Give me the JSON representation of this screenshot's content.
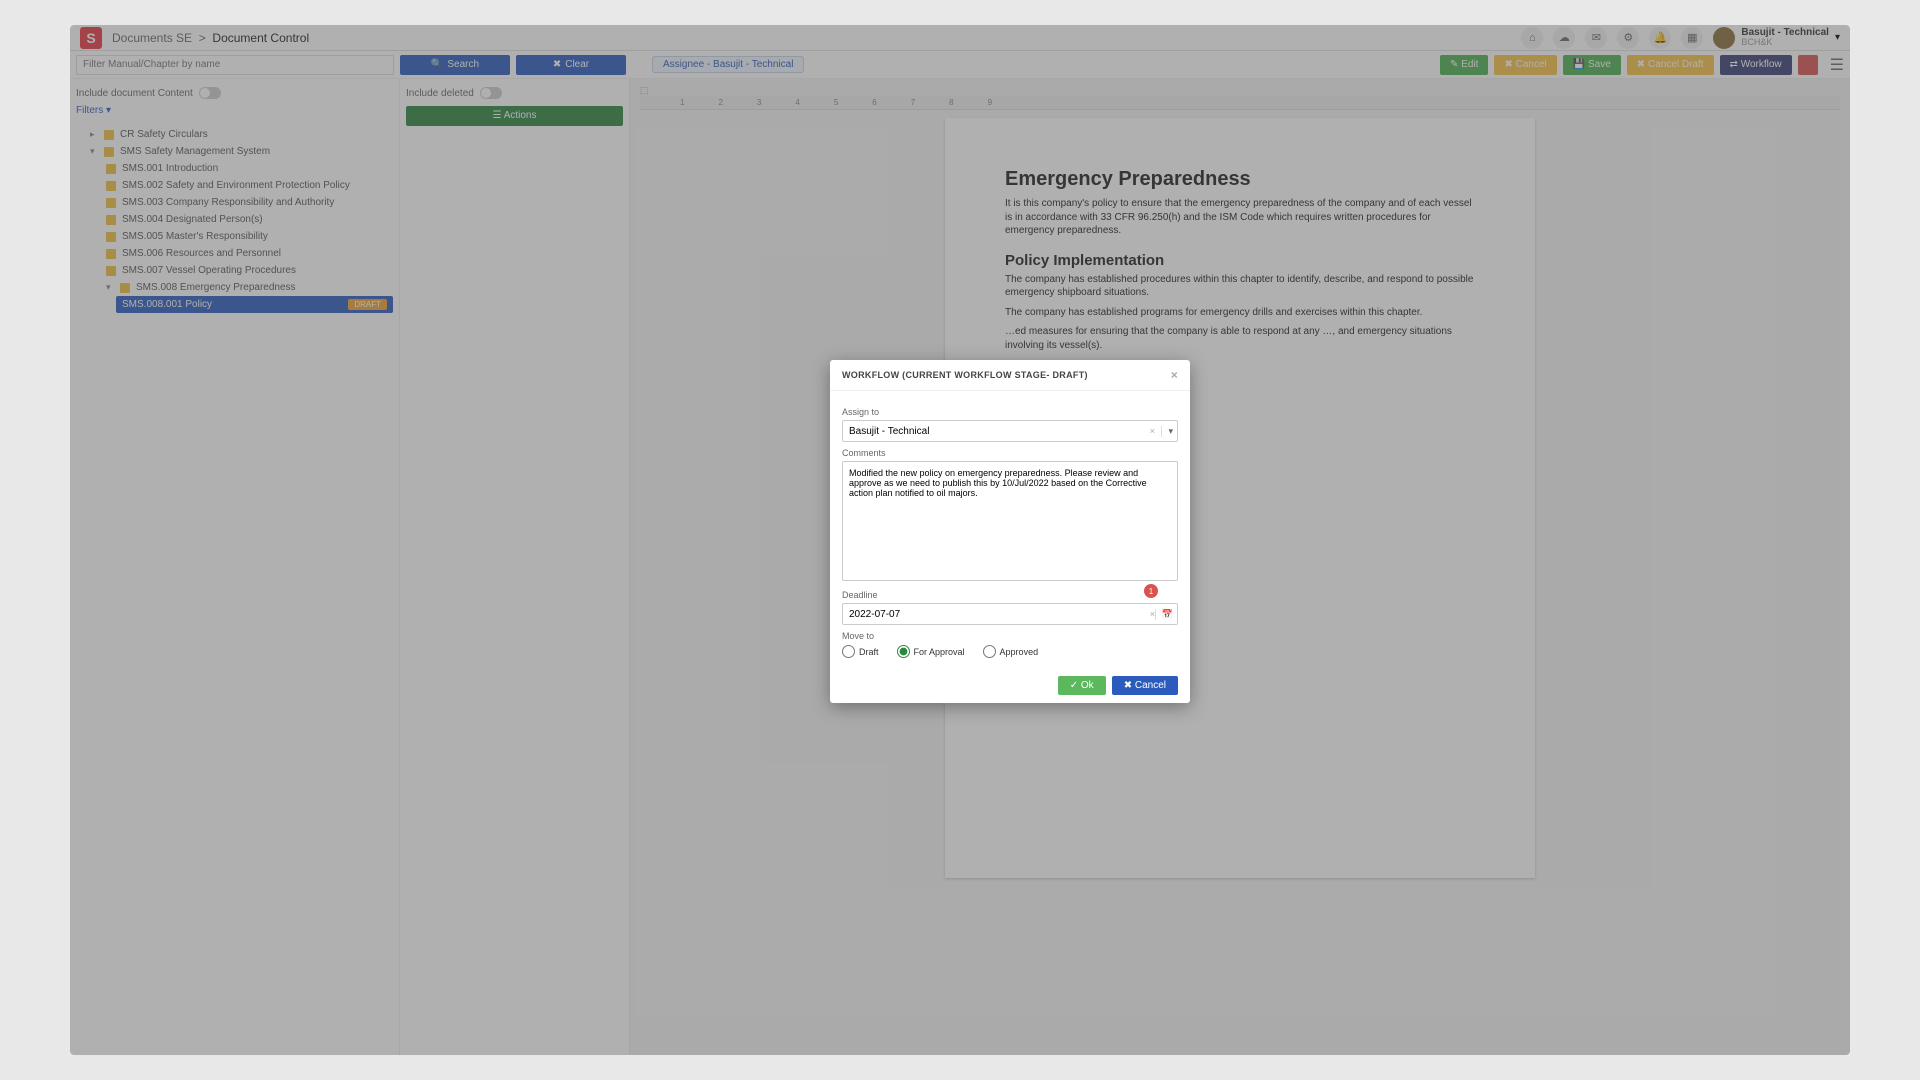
{
  "header": {
    "logo_letter": "S",
    "breadcrumb_app": "Documents SE",
    "breadcrumb_sep": ">",
    "breadcrumb_page": "Document Control",
    "user_name": "Basujit - Technical",
    "user_org": "BCH&K"
  },
  "toolbar": {
    "filter_placeholder": "Filter Manual/Chapter by name",
    "search_label": "Search",
    "clear_label": "Clear",
    "assignee_label": "Assignee - Basujit - Technical",
    "edit_label": "Edit",
    "cancel_label": "Cancel",
    "save_label": "Save",
    "cancel_draft_label": "Cancel Draft",
    "workflow_label": "Workflow",
    "delete_label": ""
  },
  "left": {
    "include_content_label": "Include document Content",
    "filters_label": "Filters",
    "tree": {
      "node1": "CR Safety Circulars",
      "node2": "SMS Safety Management System",
      "children": [
        "SMS.001 Introduction",
        "SMS.002 Safety and Environment Protection Policy",
        "SMS.003 Company Responsibility and Authority",
        "SMS.004 Designated Person(s)",
        "SMS.005 Master's Responsibility",
        "SMS.006 Resources and Personnel",
        "SMS.007 Vessel Operating Procedures",
        "SMS.008 Emergency Preparedness"
      ],
      "selected": "SMS.008.001 Policy",
      "selected_badge": "DRAFT"
    }
  },
  "mid": {
    "include_deleted_label": "Include deleted",
    "actions_label": "Actions"
  },
  "doc": {
    "h1": "Emergency Preparedness",
    "p1": "It is this company's policy to ensure that the emergency preparedness of the company and of each vessel is in accordance with 33 CFR 96.250(h) and the ISM Code which requires written procedures for emergency preparedness.",
    "h2": "Policy Implementation",
    "p2": "The company has established procedures within this chapter to identify, describe, and respond to possible emergency shipboard situations.",
    "p3": "The company has established programs for emergency drills and exercises within this chapter.",
    "p4": "…ed measures for ensuring that the company is able to respond at any …, and emergency situations involving its vessel(s)."
  },
  "modal": {
    "title": "WORKFLOW (CURRENT WORKFLOW STAGE- DRAFT)",
    "assign_label": "Assign to",
    "assign_value": "Basujit - Technical",
    "comments_label": "Comments",
    "comments_value": "Modified the new policy on emergency preparedness. Please review and approve as we need to publish this by 10/Jul/2022 based on the Corrective action plan notified to oil majors.",
    "badge_count": "1",
    "deadline_label": "Deadline",
    "deadline_value": "2022-07-07",
    "move_label": "Move to",
    "opt_draft": "Draft",
    "opt_approval": "For Approval",
    "opt_approved": "Approved",
    "ok_label": "Ok",
    "cancel_label": "Cancel"
  }
}
